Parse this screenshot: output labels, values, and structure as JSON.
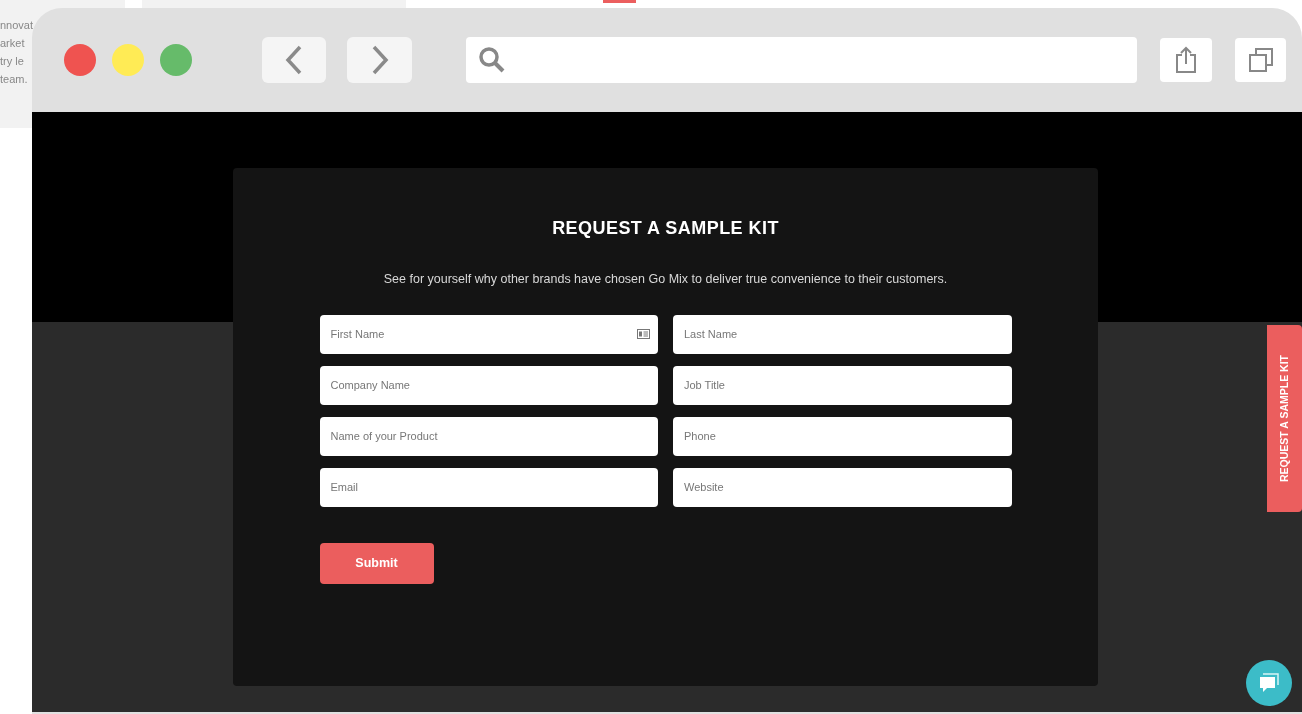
{
  "background_page": {
    "text_lines": [
      "nnovat",
      "arket",
      "try le",
      "team."
    ]
  },
  "form": {
    "title": "REQUEST A SAMPLE KIT",
    "subtitle": "See for yourself why other brands have chosen Go Mix to deliver true convenience to their customers.",
    "fields": [
      {
        "placeholder": "First Name",
        "autofill_icon": true
      },
      {
        "placeholder": "Last Name",
        "autofill_icon": false
      },
      {
        "placeholder": "Company Name",
        "autofill_icon": false
      },
      {
        "placeholder": "Job Title",
        "autofill_icon": false
      },
      {
        "placeholder": "Name of your Product",
        "autofill_icon": false
      },
      {
        "placeholder": "Phone",
        "autofill_icon": false
      },
      {
        "placeholder": "Email",
        "autofill_icon": false
      },
      {
        "placeholder": "Website",
        "autofill_icon": false
      }
    ],
    "submit": "Submit"
  },
  "side_tab": {
    "label": "REQUEST A SAMPLE KIT"
  }
}
